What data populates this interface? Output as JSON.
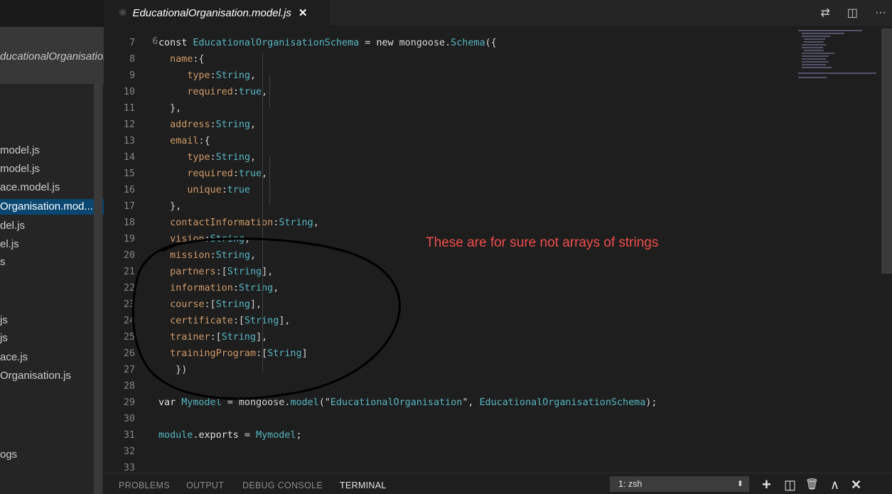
{
  "tab": {
    "file_icon": "react-atom-icon",
    "title": "EducationalOrganisation.model.js",
    "close_glyph": "✕"
  },
  "toolbar": {
    "compare_glyph": "⇄",
    "split_glyph": "◫",
    "more_glyph": "···"
  },
  "sidebar": {
    "folder_label": "EducationalOrganisation....",
    "files": [
      "model.js",
      "model.js",
      "ace.model.js",
      "Organisation.mod...",
      "del.js",
      "el.js",
      "s",
      "js",
      "js",
      "ace.js",
      "Organisation.js",
      "ogs"
    ]
  },
  "editor": {
    "first_line_number": "6",
    "lines": [
      {
        "n": "7",
        "tokens": [
          [
            "k",
            "const "
          ],
          [
            "t",
            "EducationalOrganisationSchema"
          ],
          [
            "g",
            " = "
          ],
          [
            "w",
            "new "
          ],
          [
            "g",
            "mongoose."
          ],
          [
            "t",
            "Schema"
          ],
          [
            "g",
            "({"
          ]
        ]
      },
      {
        "n": "8",
        "tokens": [
          [
            "g",
            "  "
          ],
          [
            "p",
            "name"
          ],
          [
            "g",
            ":{"
          ]
        ]
      },
      {
        "n": "9",
        "tokens": [
          [
            "g",
            "     "
          ],
          [
            "p",
            "type"
          ],
          [
            "g",
            ":"
          ],
          [
            "t",
            "String"
          ],
          [
            "g",
            ","
          ]
        ]
      },
      {
        "n": "10",
        "tokens": [
          [
            "g",
            "     "
          ],
          [
            "p",
            "required"
          ],
          [
            "g",
            ":"
          ],
          [
            "t",
            "true"
          ],
          [
            "g",
            ","
          ]
        ]
      },
      {
        "n": "11",
        "tokens": [
          [
            "g",
            "  },"
          ]
        ]
      },
      {
        "n": "12",
        "tokens": [
          [
            "g",
            "  "
          ],
          [
            "p",
            "address"
          ],
          [
            "g",
            ":"
          ],
          [
            "t",
            "String"
          ],
          [
            "g",
            ","
          ]
        ]
      },
      {
        "n": "13",
        "tokens": [
          [
            "g",
            "  "
          ],
          [
            "p",
            "email"
          ],
          [
            "g",
            ":{"
          ]
        ]
      },
      {
        "n": "14",
        "tokens": [
          [
            "g",
            "     "
          ],
          [
            "p",
            "type"
          ],
          [
            "g",
            ":"
          ],
          [
            "t",
            "String"
          ],
          [
            "g",
            ","
          ]
        ]
      },
      {
        "n": "15",
        "tokens": [
          [
            "g",
            "     "
          ],
          [
            "p",
            "required"
          ],
          [
            "g",
            ":"
          ],
          [
            "t",
            "true"
          ],
          [
            "g",
            ","
          ]
        ]
      },
      {
        "n": "16",
        "tokens": [
          [
            "g",
            "     "
          ],
          [
            "p",
            "unique"
          ],
          [
            "g",
            ":"
          ],
          [
            "t",
            "true"
          ]
        ]
      },
      {
        "n": "17",
        "tokens": [
          [
            "g",
            "  },"
          ]
        ]
      },
      {
        "n": "18",
        "tokens": [
          [
            "g",
            "  "
          ],
          [
            "p",
            "contactInformation"
          ],
          [
            "g",
            ":"
          ],
          [
            "t",
            "String"
          ],
          [
            "g",
            ","
          ]
        ]
      },
      {
        "n": "19",
        "tokens": [
          [
            "g",
            "  "
          ],
          [
            "p",
            "vision"
          ],
          [
            "g",
            ":"
          ],
          [
            "t",
            "String"
          ],
          [
            "g",
            ","
          ]
        ]
      },
      {
        "n": "20",
        "tokens": [
          [
            "g",
            "  "
          ],
          [
            "p",
            "mission"
          ],
          [
            "g",
            ":"
          ],
          [
            "t",
            "String"
          ],
          [
            "g",
            ","
          ]
        ]
      },
      {
        "n": "21",
        "tokens": [
          [
            "g",
            "  "
          ],
          [
            "p",
            "partners"
          ],
          [
            "g",
            ":["
          ],
          [
            "t",
            "String"
          ],
          [
            "g",
            "],"
          ]
        ]
      },
      {
        "n": "22",
        "tokens": [
          [
            "g",
            "  "
          ],
          [
            "p",
            "information"
          ],
          [
            "g",
            ":"
          ],
          [
            "t",
            "String"
          ],
          [
            "g",
            ","
          ]
        ]
      },
      {
        "n": "23",
        "tokens": [
          [
            "g",
            "  "
          ],
          [
            "p",
            "course"
          ],
          [
            "g",
            ":["
          ],
          [
            "t",
            "String"
          ],
          [
            "g",
            "],"
          ]
        ]
      },
      {
        "n": "24",
        "tokens": [
          [
            "g",
            "  "
          ],
          [
            "p",
            "certificate"
          ],
          [
            "g",
            ":["
          ],
          [
            "t",
            "String"
          ],
          [
            "g",
            "],"
          ]
        ]
      },
      {
        "n": "25",
        "tokens": [
          [
            "g",
            "  "
          ],
          [
            "p",
            "trainer"
          ],
          [
            "g",
            ":["
          ],
          [
            "t",
            "String"
          ],
          [
            "g",
            "],"
          ]
        ]
      },
      {
        "n": "26",
        "tokens": [
          [
            "g",
            "  "
          ],
          [
            "p",
            "trainingProgram"
          ],
          [
            "g",
            ":["
          ],
          [
            "t",
            "String"
          ],
          [
            "g",
            "]"
          ]
        ]
      },
      {
        "n": "27",
        "tokens": [
          [
            "g",
            "   })"
          ]
        ]
      },
      {
        "n": "28",
        "tokens": []
      },
      {
        "n": "29",
        "tokens": [
          [
            "k",
            "var "
          ],
          [
            "t",
            "Mymodel"
          ],
          [
            "g",
            " = mongoose."
          ],
          [
            "t",
            "model"
          ],
          [
            "g",
            "(\""
          ],
          [
            "t",
            "EducationalOrganisation"
          ],
          [
            "g",
            "\", "
          ],
          [
            "t",
            "EducationalOrganisationSchema"
          ],
          [
            "g",
            ");"
          ]
        ]
      },
      {
        "n": "30",
        "tokens": []
      },
      {
        "n": "31",
        "tokens": [
          [
            "t",
            "module"
          ],
          [
            "g",
            "."
          ],
          [
            "w",
            "exports"
          ],
          [
            "g",
            " = "
          ],
          [
            "t",
            "Mymodel"
          ],
          [
            "g",
            ";"
          ]
        ]
      },
      {
        "n": "32",
        "tokens": []
      },
      {
        "n": "33",
        "tokens": []
      }
    ]
  },
  "annotation": "These are for sure not arrays of strings",
  "panel": {
    "tabs": [
      "PROBLEMS",
      "OUTPUT",
      "DEBUG CONSOLE",
      "TERMINAL"
    ],
    "active_tab": "TERMINAL",
    "terminal_select_value": "1: zsh",
    "select_arrow": "⬍",
    "new_terminal_glyph": "+",
    "split_glyph": "◫",
    "trash_glyph": "🗑",
    "maximize_glyph": "∧",
    "close_glyph": "✕"
  },
  "colors": {
    "keyword": "#e0e0e0",
    "type": "#56b6c2",
    "property": "#d19a66",
    "annotation": "#f14c4c",
    "selection": "#094771"
  }
}
